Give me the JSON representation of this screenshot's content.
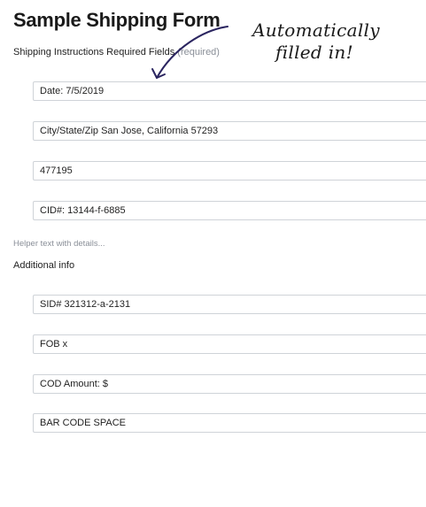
{
  "form": {
    "title": "Sample Shipping Form",
    "subtitle": "Shipping Instructions Required Fields",
    "required_tag": "(required)",
    "fields": [
      "Date: 7/5/2019",
      "City/State/Zip San Jose, California 57293",
      "477195",
      "CID#: 13144-f-6885"
    ],
    "helper_text": "Helper text with details...",
    "additional_label": "Additional info",
    "additional_fields": [
      "SID# 321312-a-2131",
      "FOB x",
      "COD Amount: $",
      "BAR CODE SPACE"
    ]
  },
  "annotation": {
    "line1": "Automatically",
    "line2": "filled in!",
    "arrow_color": "#2b2560"
  }
}
